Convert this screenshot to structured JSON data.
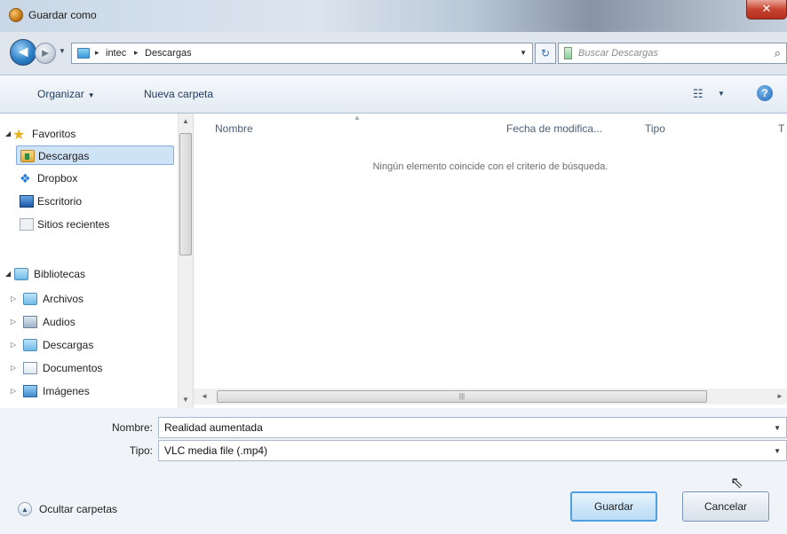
{
  "window": {
    "title": "Guardar como",
    "close_glyph": "✕"
  },
  "nav": {
    "back_glyph": "◄",
    "forward_glyph": "►",
    "dropdown_glyph": "▼",
    "breadcrumbs": [
      "intec",
      "Descargas"
    ],
    "crumb_separator": "▸",
    "refresh_glyph": "↻",
    "search_placeholder": "Buscar Descargas",
    "search_glyph": "⌕"
  },
  "toolbar": {
    "organize_label": "Organizar",
    "new_folder_label": "Nueva carpeta",
    "view_glyph": "☷",
    "help_glyph": "?"
  },
  "sidebar": {
    "favorites": {
      "label": "Favoritos",
      "items": [
        {
          "label": "Descargas",
          "icon": "downloads-folder-icon"
        },
        {
          "label": "Dropbox",
          "icon": "dropbox-icon"
        },
        {
          "label": "Escritorio",
          "icon": "desktop-icon"
        },
        {
          "label": "Sitios recientes",
          "icon": "recent-places-icon"
        }
      ]
    },
    "libraries": {
      "label": "Bibliotecas",
      "items": [
        {
          "label": "Archivos",
          "icon": "library-icon"
        },
        {
          "label": "Audios",
          "icon": "music-library-icon"
        },
        {
          "label": "Descargas",
          "icon": "library-icon"
        },
        {
          "label": "Documentos",
          "icon": "documents-library-icon"
        },
        {
          "label": "Imágenes",
          "icon": "pictures-library-icon"
        }
      ]
    }
  },
  "filelist": {
    "columns": [
      "Nombre",
      "Fecha de modifica...",
      "Tipo",
      "T"
    ],
    "empty_message": "Ningún elemento coincide con el criterio de búsqueda.",
    "scroll_grip": "|||"
  },
  "form": {
    "name_label": "Nombre:",
    "name_value": "Realidad aumentada",
    "type_label": "Tipo:",
    "type_value": "VLC media file (.mp4)",
    "hide_folders_label": "Ocultar carpetas",
    "save_label": "Guardar",
    "cancel_label": "Cancelar"
  },
  "colors": {
    "selection": "#cfe3f7",
    "primary_button_border": "#4da0e3",
    "close_button": "#c8442f"
  }
}
